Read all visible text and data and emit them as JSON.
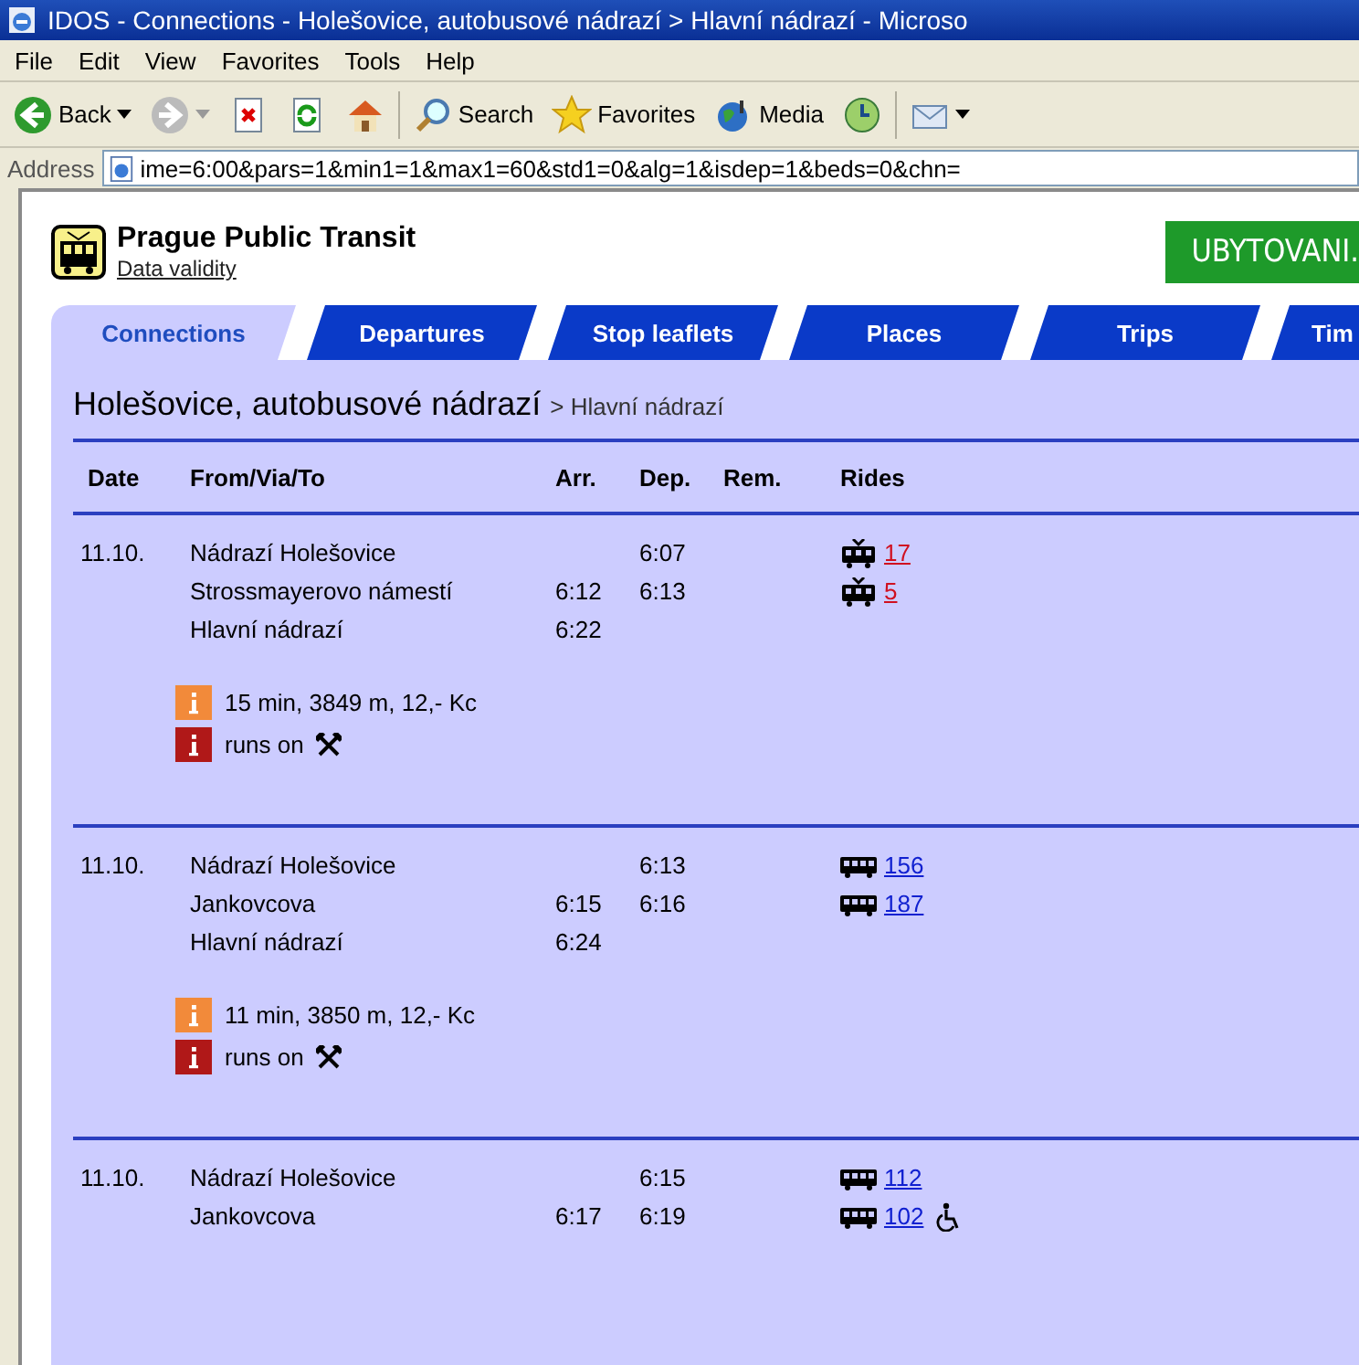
{
  "window": {
    "title": "IDOS - Connections - Holešovice, autobusové nádrazí > Hlavní nádrazí - Microso"
  },
  "menu": [
    "File",
    "Edit",
    "View",
    "Favorites",
    "Tools",
    "Help"
  ],
  "toolbar": [
    {
      "kind": "back",
      "label": "Back"
    },
    {
      "kind": "forward"
    },
    {
      "kind": "stop"
    },
    {
      "kind": "refresh"
    },
    {
      "kind": "home"
    },
    {
      "kind": "search",
      "label": "Search"
    },
    {
      "kind": "favorites",
      "label": "Favorites"
    },
    {
      "kind": "media",
      "label": "Media"
    },
    {
      "kind": "history"
    },
    {
      "kind": "mail"
    }
  ],
  "address": {
    "label": "Address",
    "value": "ime=6:00&pars=1&min1=1&max1=60&std1=0&alg=1&isdep=1&beds=0&chn="
  },
  "site": {
    "title": "Prague Public Transit",
    "link": "Data validity",
    "banner": "UBYTOVANI."
  },
  "tabs": [
    {
      "label": "Connections",
      "selected": true
    },
    {
      "label": "Departures",
      "selected": false
    },
    {
      "label": "Stop leaflets",
      "selected": false
    },
    {
      "label": "Places",
      "selected": false
    },
    {
      "label": "Trips",
      "selected": false
    },
    {
      "label": "Tim",
      "selected": false
    }
  ],
  "heading": {
    "from": "Holešovice, autobusové nádrazí",
    "to": "> Hlavní nádrazí"
  },
  "columns": [
    "Date",
    "From/Via/To",
    "Arr.",
    "Dep.",
    "Rem.",
    "Rides"
  ],
  "connections": [
    {
      "date": "11.10.",
      "stops": [
        {
          "name": "Nádrazí Holešovice",
          "dep": "6:07",
          "ride": {
            "kind": "tram",
            "number": "17",
            "accessible": false
          }
        },
        {
          "name": "Strossmayerovo námestí",
          "arr": "6:12",
          "dep": "6:13",
          "ride": {
            "kind": "tram",
            "number": "5",
            "accessible": false
          }
        },
        {
          "name": "Hlavní nádrazí",
          "arr": "6:22"
        }
      ],
      "info": [
        {
          "kind": "summary",
          "text": "15 min, 3849 m, 12,- Kc"
        },
        {
          "kind": "runs_on",
          "text": "runs on",
          "workdays": true
        }
      ]
    },
    {
      "date": "11.10.",
      "stops": [
        {
          "name": "Nádrazí Holešovice",
          "dep": "6:13",
          "ride": {
            "kind": "bus",
            "number": "156",
            "accessible": false
          }
        },
        {
          "name": "Jankovcova",
          "arr": "6:15",
          "dep": "6:16",
          "ride": {
            "kind": "bus",
            "number": "187",
            "accessible": false
          }
        },
        {
          "name": "Hlavní nádrazí",
          "arr": "6:24"
        }
      ],
      "info": [
        {
          "kind": "summary",
          "text": "11 min, 3850 m, 12,- Kc"
        },
        {
          "kind": "runs_on",
          "text": "runs on",
          "workdays": true
        }
      ]
    },
    {
      "date": "11.10.",
      "stops": [
        {
          "name": "Nádrazí Holešovice",
          "dep": "6:15",
          "ride": {
            "kind": "bus",
            "number": "112",
            "accessible": false
          }
        },
        {
          "name": "Jankovcova",
          "arr": "6:17",
          "dep": "6:19",
          "ride": {
            "kind": "bus",
            "number": "102",
            "accessible": true
          }
        }
      ]
    }
  ]
}
